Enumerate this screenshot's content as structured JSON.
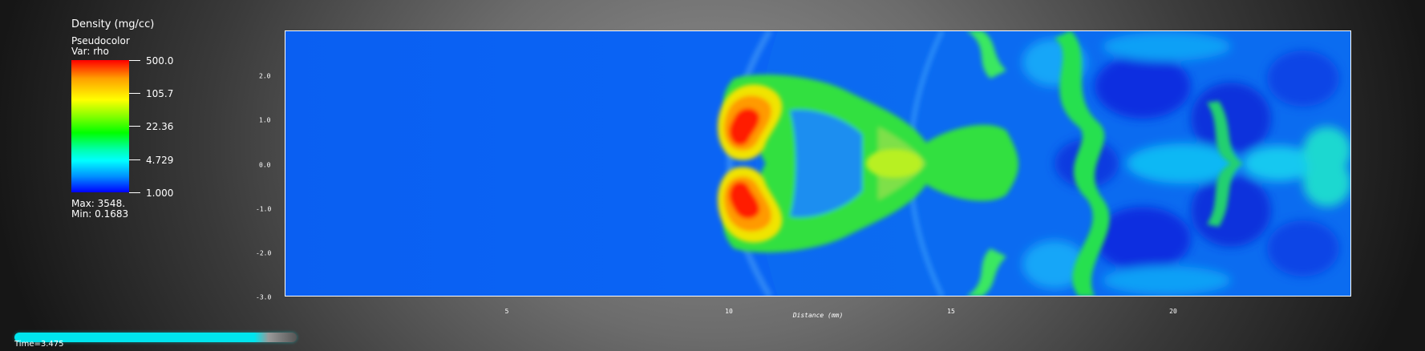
{
  "legend": {
    "title": "Density (mg/cc)",
    "plot_name": "Pseudocolor",
    "variable": "Var: rho",
    "ticks": [
      "500.0",
      "105.7",
      "22.36",
      "4.729",
      "1.000"
    ],
    "max": "Max:  3548.",
    "min": "Min:  0.1683",
    "scale": "log"
  },
  "axes": {
    "y_ticks": [
      "2.0",
      "1.0",
      "0.0",
      "-1.0",
      "-2.0",
      "-3.0"
    ],
    "x_ticks": [
      "5",
      "10",
      "15",
      "20"
    ],
    "x_title": "Distance (mm)"
  },
  "time": {
    "label": "Time=3.475",
    "progress": 0.88
  },
  "colors": {
    "background_field": "#0a64f0",
    "high_density": "#ff0000",
    "accent_timebar": "#00e5ee"
  }
}
